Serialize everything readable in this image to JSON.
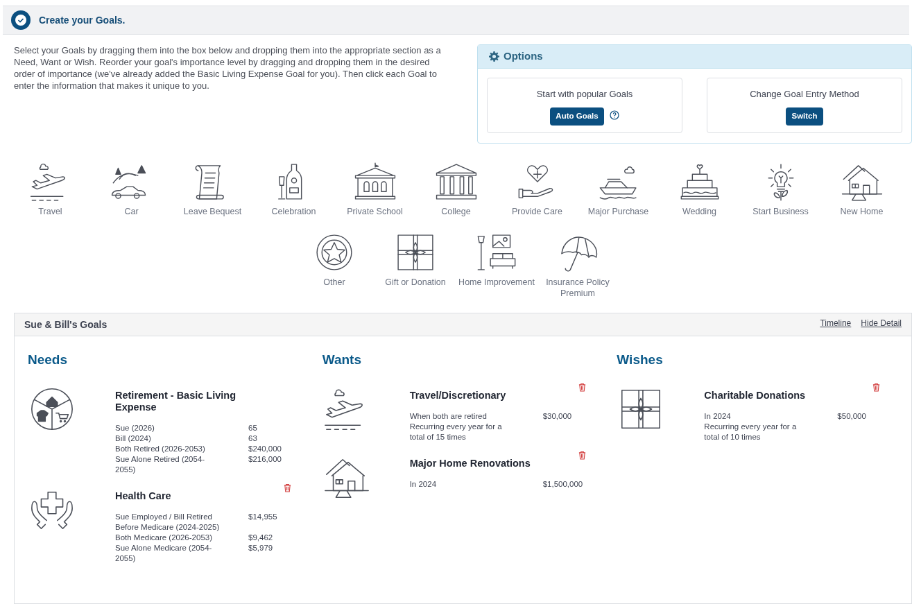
{
  "step": {
    "title": "Create your Goals."
  },
  "instructions": "Select your Goals by dragging them into the box below and dropping them into the appropriate section as a Need, Want or Wish. Reorder your goal's importance level by dragging and dropping them in the desired order of importance (we've already added the Basic Living Expense Goal for you). Then click each Goal to enter the information that makes it unique to you.",
  "options": {
    "title": "Options",
    "cards": [
      {
        "label": "Start with popular Goals",
        "button": "Auto Goals",
        "help": true
      },
      {
        "label": "Change Goal Entry Method",
        "button": "Switch",
        "help": false
      }
    ]
  },
  "goal_palette": [
    {
      "label": "Travel",
      "kind": "plane"
    },
    {
      "label": "Car",
      "kind": "car"
    },
    {
      "label": "Leave Bequest",
      "kind": "scroll"
    },
    {
      "label": "Celebration",
      "kind": "champagne"
    },
    {
      "label": "Private School",
      "kind": "school"
    },
    {
      "label": "College",
      "kind": "columns"
    },
    {
      "label": "Provide Care",
      "kind": "heart"
    },
    {
      "label": "Major Purchase",
      "kind": "boat"
    },
    {
      "label": "Wedding",
      "kind": "cake"
    },
    {
      "label": "Start Business",
      "kind": "bulb"
    },
    {
      "label": "New Home",
      "kind": "house"
    },
    {
      "label": "Other",
      "kind": "star"
    },
    {
      "label": "Gift or Donation",
      "kind": "gift"
    },
    {
      "label": "Home Improvement",
      "kind": "sofa"
    },
    {
      "label": "Insurance Policy Premium",
      "kind": "umbrella"
    }
  ],
  "goals_panel": {
    "title": "Sue & Bill's Goals",
    "links": [
      "Timeline",
      "Hide Detail"
    ],
    "sections": [
      {
        "title": "Needs",
        "goals": [
          {
            "title": "Retirement - Basic Living Expense",
            "kind": "basics",
            "removable": false,
            "details": [
              {
                "label": "Sue (2026)",
                "value": "65"
              },
              {
                "label": "Bill (2024)",
                "value": "63"
              },
              {
                "label": "Both Retired (2026-2053)",
                "value": "$240,000"
              },
              {
                "label": "Sue Alone Retired (2054-2055)",
                "value": "$216,000"
              }
            ]
          },
          {
            "title": "Health Care",
            "kind": "health",
            "removable": true,
            "details": [
              {
                "label": "Sue Employed / Bill Retired Before Medicare (2024-2025)",
                "value": "$14,955"
              },
              {
                "label": "Both Medicare (2026-2053)",
                "value": "$9,462"
              },
              {
                "label": "Sue Alone Medicare (2054-2055)",
                "value": "$5,979"
              }
            ]
          }
        ]
      },
      {
        "title": "Wants",
        "goals": [
          {
            "title": "Travel/Discretionary",
            "kind": "plane",
            "removable": true,
            "details": [
              {
                "label": "When both are retired",
                "value": "$30,000"
              },
              {
                "label": "Recurring every year for a total of 15 times"
              }
            ]
          },
          {
            "title": "Major Home Renovations",
            "kind": "house",
            "removable": true,
            "details": [
              {
                "label": "In 2024",
                "value": "$1,500,000"
              }
            ]
          }
        ]
      },
      {
        "title": "Wishes",
        "goals": [
          {
            "title": "Charitable Donations",
            "kind": "gift",
            "removable": true,
            "details": [
              {
                "label": "In 2024",
                "value": "$50,000"
              },
              {
                "label": "Recurring every year for a total of 10 times"
              }
            ]
          }
        ]
      }
    ]
  }
}
